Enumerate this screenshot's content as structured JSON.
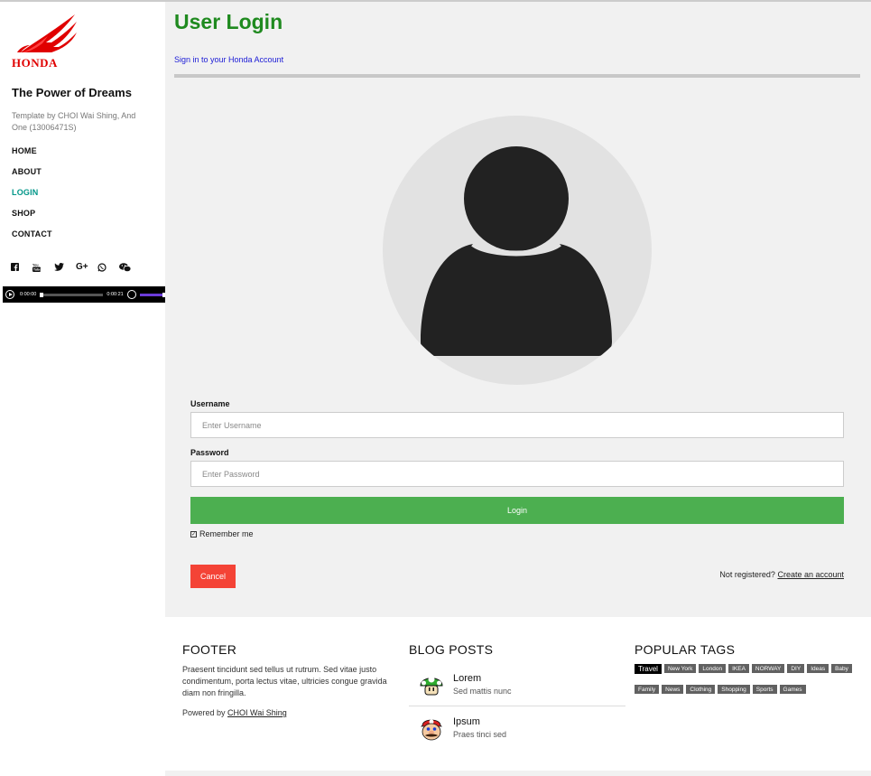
{
  "brand": {
    "logo_text": "HONDA",
    "title": "The Power of Dreams",
    "subtitle": "Template by CHOI Wai Shing, And One (13006471S)"
  },
  "nav": {
    "items": [
      {
        "label": "HOME",
        "active": false
      },
      {
        "label": "ABOUT",
        "active": false
      },
      {
        "label": "LOGIN",
        "active": true
      },
      {
        "label": "SHOP",
        "active": false
      },
      {
        "label": "CONTACT",
        "active": false
      }
    ]
  },
  "social": [
    "facebook-icon",
    "youtube-icon",
    "twitter-icon",
    "google-plus-icon",
    "whatsapp-icon",
    "wechat-icon"
  ],
  "audio": {
    "current_time": "0:00:00",
    "duration": "0:00:21",
    "progress": 0.0,
    "volume": 0.9
  },
  "main": {
    "title": "User Login",
    "subtitle": "Sign in to your Honda Account",
    "username_label": "Username",
    "username_placeholder": "Enter Username",
    "password_label": "Password",
    "password_placeholder": "Enter Password",
    "login_label": "Login",
    "remember_label": "Remember me",
    "remember_checked": true,
    "cancel_label": "Cancel",
    "not_registered": "Not registered?",
    "create_account": "Create an account"
  },
  "footer": {
    "col1_title": "FOOTER",
    "col1_text": "Praesent tincidunt sed tellus ut rutrum. Sed vitae justo condimentum, porta lectus vitae, ultricies congue gravida diam non fringilla.",
    "powered_prefix": "Powered by",
    "powered_link": "CHOI Wai Shing",
    "col2_title": "BLOG POSTS",
    "posts": [
      {
        "title": "Lorem",
        "subtitle": "Sed mattis nunc"
      },
      {
        "title": "Ipsum",
        "subtitle": "Praes tinci sed"
      }
    ],
    "col3_title": "POPULAR TAGS",
    "tags": [
      "Travel",
      "New York",
      "London",
      "IKEA",
      "NORWAY",
      "DIY",
      "Ideas",
      "Baby",
      "Family",
      "News",
      "Clothing",
      "Shopping",
      "Sports",
      "Games"
    ],
    "active_tag": "Travel"
  },
  "colors": {
    "accent_green": "#1f8a1f",
    "login_green": "#4caf50",
    "cancel_red": "#f44336",
    "active_nav": "#009688",
    "honda_red": "#e00000"
  }
}
